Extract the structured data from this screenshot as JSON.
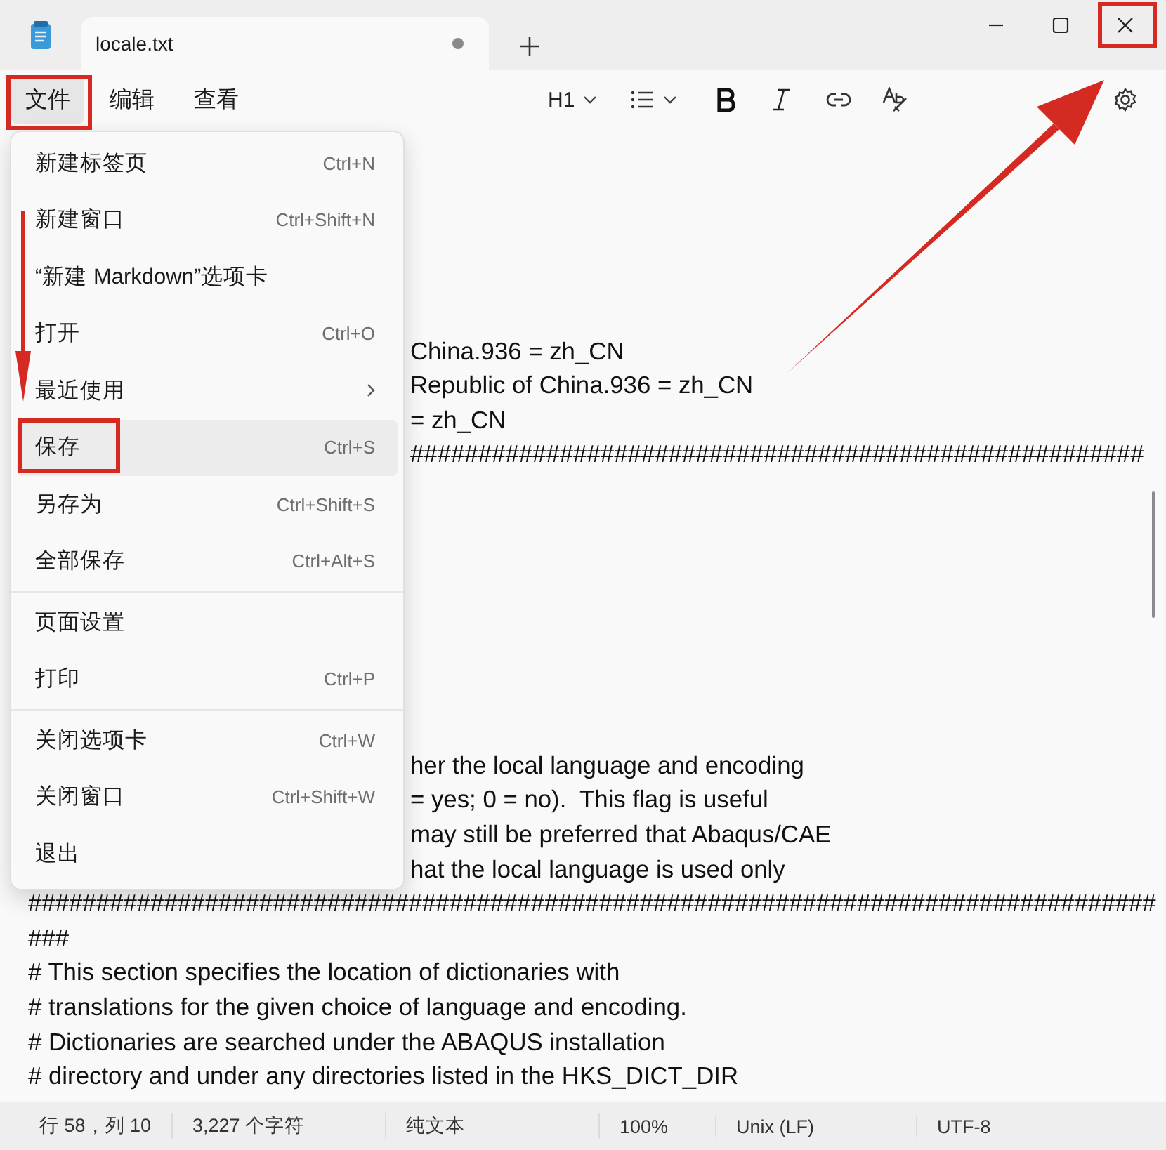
{
  "window": {
    "tab": {
      "title": "locale.txt",
      "unsaved": true
    },
    "close_annotated": true
  },
  "menubar": [
    {
      "label": "文件",
      "selected": true,
      "annotated": true
    },
    {
      "label": "编辑",
      "selected": false,
      "annotated": false
    },
    {
      "label": "查看",
      "selected": false,
      "annotated": false
    }
  ],
  "format_toolbar": {
    "heading": "H1"
  },
  "file_menu": {
    "groups": [
      [
        {
          "label": "新建标签页",
          "shortcut": "Ctrl+N",
          "kind": "item",
          "selected": false,
          "annotated": false
        },
        {
          "label": "新建窗口",
          "shortcut": "Ctrl+Shift+N",
          "kind": "item",
          "selected": false,
          "annotated": false
        },
        {
          "label": "“新建 Markdown”选项卡",
          "kind": "item",
          "selected": false,
          "annotated": false
        },
        {
          "label": "打开",
          "shortcut": "Ctrl+O",
          "kind": "item",
          "selected": false,
          "annotated": false
        },
        {
          "label": "最近使用",
          "kind": "submenu",
          "selected": false,
          "annotated": false
        },
        {
          "label": "保存",
          "shortcut": "Ctrl+S",
          "kind": "item",
          "selected": true,
          "annotated": true
        },
        {
          "label": "另存为",
          "shortcut": "Ctrl+Shift+S",
          "kind": "item",
          "selected": false,
          "annotated": false
        },
        {
          "label": "全部保存",
          "shortcut": "Ctrl+Alt+S",
          "kind": "item",
          "selected": false,
          "annotated": false
        }
      ],
      [
        {
          "label": "页面设置",
          "kind": "item",
          "selected": false,
          "annotated": false
        },
        {
          "label": "打印",
          "shortcut": "Ctrl+P",
          "kind": "item",
          "selected": false,
          "annotated": false
        }
      ],
      [
        {
          "label": "关闭选项卡",
          "shortcut": "Ctrl+W",
          "kind": "item",
          "selected": false,
          "annotated": false
        },
        {
          "label": "关闭窗口",
          "shortcut": "Ctrl+Shift+W",
          "kind": "item",
          "selected": false,
          "annotated": false
        },
        {
          "label": "退出",
          "kind": "item",
          "selected": false,
          "annotated": false
        }
      ]
    ]
  },
  "editor": {
    "blocks": [
      {
        "kind": "behind_menu",
        "lines": [
          "China.936 = zh_CN",
          "Republic of China.936 = zh_CN",
          "= zh_CN",
          "######################################################"
        ]
      },
      {
        "kind": "behind_menu",
        "lines": [
          "her the local language and encoding",
          "= yes; 0 = no).  This flag is useful",
          "may still be preferred that Abaqus/CAE",
          "hat the local language is used only"
        ]
      },
      {
        "kind": "full",
        "lines": [
          "###################################################################################",
          "###",
          "# This section specifies the location of dictionaries with",
          "# translations for the given choice of language and encoding.",
          "# Dictionaries are searched under the ABAQUS installation",
          "# directory and under any directories listed in the HKS_DICT_DIR"
        ]
      }
    ]
  },
  "status_bar": [
    "行 58，列 10",
    "3,227 个字符",
    "纯文本",
    "100%",
    "Unix (LF)",
    "UTF-8"
  ]
}
